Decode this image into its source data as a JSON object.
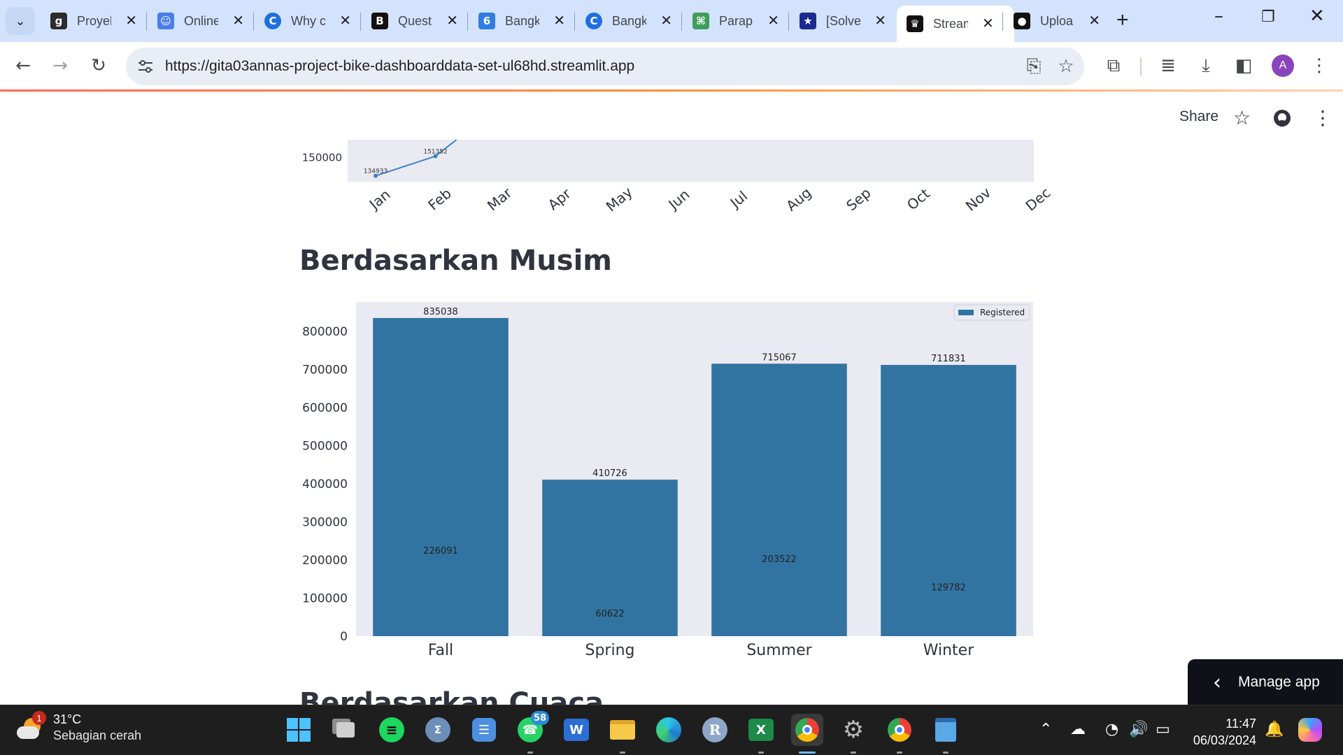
{
  "browser": {
    "tabs": [
      {
        "title": "Proyek",
        "favicon": "g",
        "color": "#2b2b2b"
      },
      {
        "title": "Online",
        "favicon": "person",
        "color": "#4a7de8"
      },
      {
        "title": "Why c",
        "favicon": "C",
        "color": "#1f6fe0"
      },
      {
        "title": "Quest",
        "favicon": "B",
        "color": "#111111"
      },
      {
        "title": "Bangk",
        "favicon": "6",
        "color": "#2f7de1"
      },
      {
        "title": "Bangk",
        "favicon": "C",
        "color": "#1f6fe0"
      },
      {
        "title": "Parap",
        "favicon": "bot",
        "color": "#3f9d5b"
      },
      {
        "title": "[Solve",
        "favicon": "star",
        "color": "#1b2a8f"
      },
      {
        "title": "Stream",
        "favicon": "crown",
        "color": "#111111"
      },
      {
        "title": "Uploa",
        "favicon": "github",
        "color": "#111111"
      }
    ],
    "url": "https://gita03annas-project-bike-dashboarddata-set-ul68hd.streamlit.app",
    "profile_initial": "A"
  },
  "streamlit": {
    "share_label": "Share",
    "section_title": "Berdasarkan Musim",
    "next_section_title": "Berdasarkan Cuaca",
    "manage_app_label": "Manage app"
  },
  "chart_data": [
    {
      "type": "line",
      "title": "",
      "categories": [
        "Jan",
        "Feb",
        "Mar",
        "Apr",
        "May",
        "Jun",
        "Jul",
        "Aug",
        "Sep",
        "Oct",
        "Nov",
        "Dec"
      ],
      "series": [
        {
          "values": [
            134933,
            151352
          ]
        }
      ],
      "point_labels": [
        "134933",
        "151352"
      ],
      "yticks": [
        "150000"
      ],
      "visible_ylim": [
        130000,
        165000
      ],
      "color": "#3b7fc4",
      "background": "#eaeaf2"
    },
    {
      "type": "bar",
      "title": "",
      "categories": [
        "Fall",
        "Spring",
        "Summer",
        "Winter"
      ],
      "series": [
        {
          "name": "Registered",
          "values": [
            835038,
            410726,
            715067,
            711831
          ]
        }
      ],
      "inner_labels": [
        "226091",
        "60622",
        "203522",
        "129782"
      ],
      "yticks": [
        "0",
        "100000",
        "200000",
        "300000",
        "400000",
        "500000",
        "600000",
        "700000",
        "800000"
      ],
      "ylim": [
        0,
        877000
      ],
      "legend": "top-right",
      "color": "#3274a1",
      "background": "#eaeaf2"
    }
  ],
  "taskbar": {
    "weather_temp": "31°C",
    "weather_desc": "Sebagian cerah",
    "weather_badge": "1",
    "whatsapp_badge": "58",
    "time": "11:47",
    "date": "06/03/2024"
  }
}
